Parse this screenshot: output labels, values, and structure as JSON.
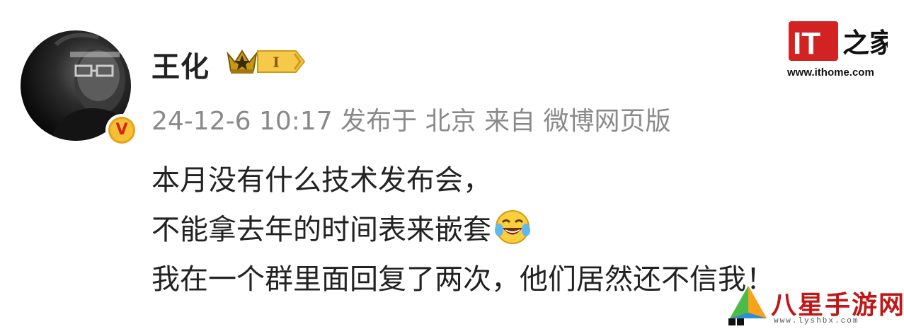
{
  "post": {
    "author": "王化",
    "level_badge": "I",
    "meta": "24-12-6 10:17 发布于 北京 来自 微博网页版",
    "lines": [
      "本月没有什么技术发布会，",
      "不能拿去年的时间表来嵌套",
      "我在一个群里面回复了两次，他们居然还不信我！"
    ],
    "emoji": "laughing-crying-emoji",
    "verified_mark": "V"
  },
  "watermarks": {
    "ithome_logo": "IT之家",
    "ithome_url": "www.ithome.com",
    "site_title": "八星手游网",
    "site_url": "www.lyshbx.com"
  },
  "colors": {
    "text": "#222222",
    "meta": "#8a8a8a",
    "ithome_red": "#d22222",
    "badge_gold": "#f5c033"
  }
}
